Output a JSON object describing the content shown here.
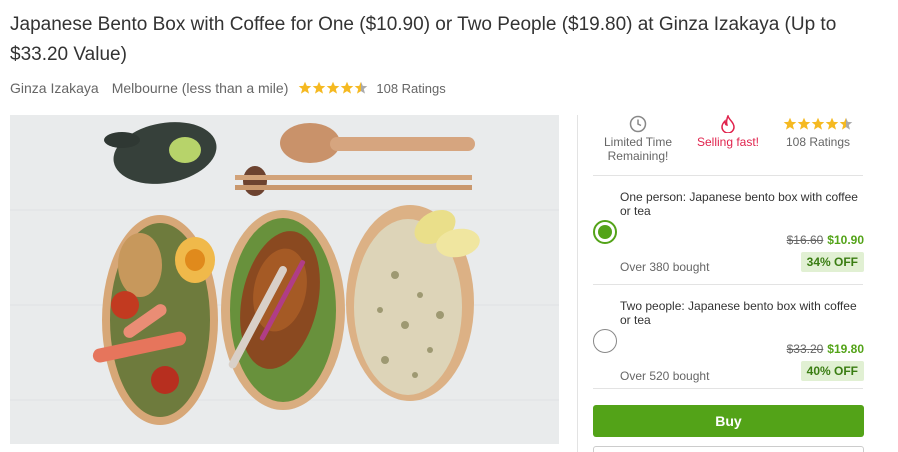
{
  "deal": {
    "title": "Japanese Bento Box with Coffee for One ($10.90) or Two People ($19.80) at Ginza Izakaya (Up to $33.20 Value)",
    "merchant": "Ginza Izakaya",
    "location": "Melbourne (less than a mile)",
    "rating_stars": 4.5,
    "ratings_text": "108 Ratings"
  },
  "hero_image": {
    "subject": "bento-boxes-photo"
  },
  "highlights": {
    "limited_time": "Limited Time Remaining!",
    "selling_fast": "Selling fast!",
    "ratings": "108 Ratings",
    "rating_stars": 4.5
  },
  "options": [
    {
      "title": "One person: Japanese bento box with coffee or tea",
      "original_price": "$16.60",
      "price": "$10.90",
      "bought": "Over 380 bought",
      "discount": "34% OFF",
      "selected": true
    },
    {
      "title": "Two people: Japanese bento box with coffee or tea",
      "original_price": "$33.20",
      "price": "$19.80",
      "bought": "Over 520 bought",
      "discount": "40% OFF",
      "selected": false
    }
  ],
  "actions": {
    "buy_label": "Buy",
    "gift_label": ""
  },
  "colors": {
    "accent_green": "#53a318",
    "discount_bg": "#e1f0d3",
    "selling_red": "#e0234d",
    "star_gold": "#f5b921"
  }
}
